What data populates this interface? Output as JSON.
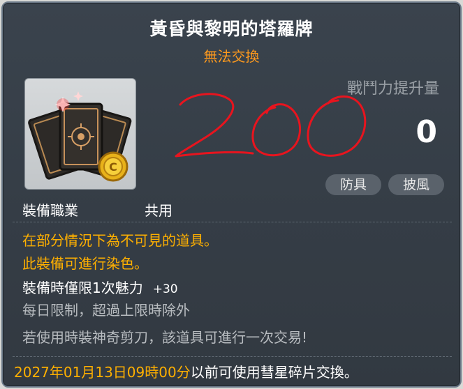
{
  "item": {
    "name": "黃昏與黎明的塔羅牌",
    "trade_status": "無法交換"
  },
  "stats": {
    "header": "戰鬥力提升量",
    "value": "0",
    "tags": [
      "防具",
      "披風"
    ]
  },
  "annotation": {
    "handwritten_text": "200",
    "color": "#e8141e"
  },
  "requirements": {
    "job_label": "裝備職業",
    "job_value": "共用"
  },
  "description": {
    "lines": [
      "在部分情況下為不可見的道具。",
      "此裝備可進行染色。"
    ],
    "charm_label": "裝備時僅限1次魅力",
    "charm_bonus": "+30",
    "daily_limit": "每日限制，超過上限時除外",
    "scissors_note": "若使用時裝神奇剪刀，該道具可進行一次交易!"
  },
  "footer": {
    "date": "2027年01月13日09時00分",
    "note": "以前可使用彗星碎片交換。"
  },
  "icons": {
    "item_icon": "tarot-cards-icon",
    "coin_icon": "coin-icon"
  },
  "colors": {
    "title": "#ffffff",
    "trade_status": "#ff9a1d",
    "highlight": "#ffb000",
    "tooltip_bg": "#353d46"
  }
}
